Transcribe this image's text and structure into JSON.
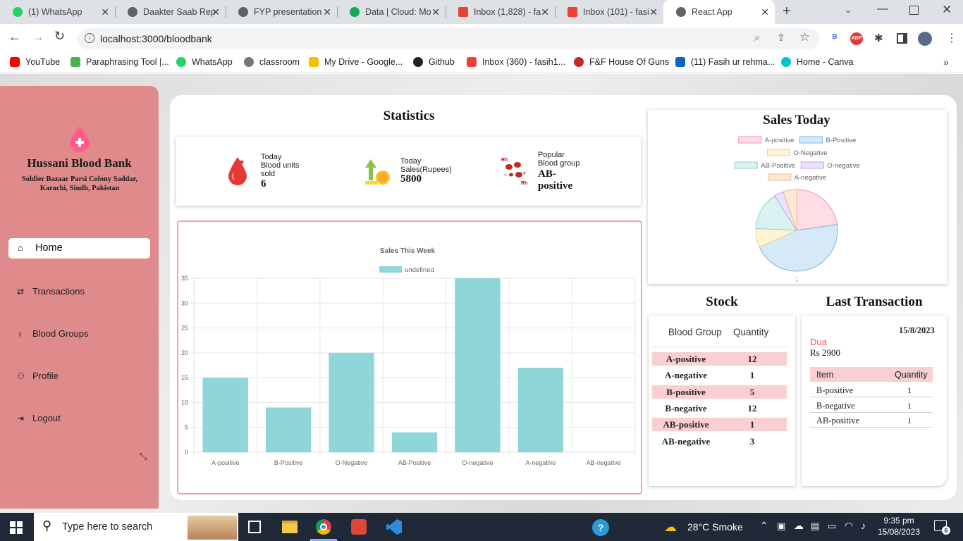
{
  "browser": {
    "tabs": [
      {
        "label": "(1) WhatsApp",
        "favicon_color": "#25d366"
      },
      {
        "label": "Daakter Saab Rep",
        "favicon_color": "#5f6368"
      },
      {
        "label": "FYP presentation",
        "favicon_color": "#5f6368"
      },
      {
        "label": "Data | Cloud: Mo",
        "favicon_color": "#13aa52"
      },
      {
        "label": "Inbox (1,828) - fa",
        "favicon_color": "#ea4335"
      },
      {
        "label": "Inbox (101) - fasi",
        "favicon_color": "#ea4335"
      },
      {
        "label": "React App",
        "favicon_color": "#5f6368"
      }
    ],
    "url": "localhost:3000/bloodbank",
    "bookmarks": [
      {
        "label": "YouTube",
        "color": "#ff0000"
      },
      {
        "label": "Paraphrasing Tool |...",
        "color": "#4caf50"
      },
      {
        "label": "WhatsApp",
        "color": "#25d366"
      },
      {
        "label": "classroom",
        "color": "#555555"
      },
      {
        "label": "My Drive - Google...",
        "color": "#fbbc04"
      },
      {
        "label": "Github",
        "color": "#222222"
      },
      {
        "label": "Inbox (360) - fasih1...",
        "color": "#ea4335"
      },
      {
        "label": "F&F House Of Guns",
        "color": "#c62828"
      },
      {
        "label": "(11) Fasih ur rehma...",
        "color": "#0a66c2"
      },
      {
        "label": "Home - Canva",
        "color": "#00c4cc"
      }
    ]
  },
  "sidebar": {
    "title": "Hussani Blood Bank",
    "address": "Soldier Bazaar Parsi Colony Saddar, Karachi, Sindh, Pakistan",
    "items": [
      {
        "label": "Home",
        "icon": "home-icon"
      },
      {
        "label": "Transactions",
        "icon": "transactions-icon"
      },
      {
        "label": "Blood Groups",
        "icon": "blood-drop-icon"
      },
      {
        "label": "Profile",
        "icon": "user-icon"
      },
      {
        "label": "Logout",
        "icon": "logout-icon"
      }
    ],
    "active": "Home"
  },
  "statistics": {
    "title": "Statistics",
    "units_label_1": "Today",
    "units_label_2": "Blood units",
    "units_label_3": "sold",
    "units_value": "6",
    "sales_label_1": "Today",
    "sales_label_2": "Sales(Rupees)",
    "sales_value": "5800",
    "popular_label_1": "Popular",
    "popular_label_2": "Blood group",
    "popular_value_1": "AB-",
    "popular_value_2": "positive"
  },
  "chart_data": [
    {
      "type": "bar",
      "title": "Sales This Week",
      "legend": [
        "undefined"
      ],
      "legend_position": "top",
      "categories": [
        "A-positive",
        "B-Positive",
        "O-Negative",
        "AB-Positive",
        "O-negative",
        "A-negative",
        "AB-negative"
      ],
      "values": [
        15,
        9,
        20,
        4,
        35,
        17,
        0
      ],
      "ylim": [
        0,
        35
      ],
      "yticks": [
        0,
        5,
        10,
        15,
        20,
        25,
        30,
        35
      ],
      "grid": true,
      "color": "#8fd6d9"
    },
    {
      "type": "pie",
      "title": "Sales Today",
      "labels": [
        "A-positive",
        "B-Positive",
        "O-Negative",
        "AB-Positive",
        "O-negative",
        "A-negative"
      ],
      "values": [
        3,
        6,
        1,
        2,
        0.5,
        0.7
      ],
      "colors": [
        "#ffdde4",
        "#d6e9f8",
        "#fff3d6",
        "#daf3f1",
        "#ebe2fb",
        "#ffe8d4"
      ],
      "borders": [
        "#f48fa8",
        "#75b6e3",
        "#f1cf83",
        "#88d6d0",
        "#bda7ec",
        "#f3b98a"
      ],
      "legend_position": "top",
      "caption": ";"
    }
  ],
  "stock": {
    "title": "Stock",
    "headers": [
      "Blood Group",
      "Quantity"
    ],
    "rows": [
      {
        "group": "A-positive",
        "qty": "12"
      },
      {
        "group": "A-negative",
        "qty": "1"
      },
      {
        "group": "B-positive",
        "qty": "5"
      },
      {
        "group": "B-negative",
        "qty": "12"
      },
      {
        "group": "AB-positive",
        "qty": "1"
      },
      {
        "group": "AB-negative",
        "qty": "3"
      }
    ]
  },
  "last_transaction": {
    "title": "Last Transaction",
    "date": "15/8/2023",
    "name": "Dua",
    "amount": "Rs 2900",
    "headers": [
      "Item",
      "Quantity"
    ],
    "rows": [
      {
        "item": "B-positive",
        "qty": "1"
      },
      {
        "item": "B-negative",
        "qty": "1"
      },
      {
        "item": "AB-positive",
        "qty": "1"
      }
    ]
  },
  "taskbar": {
    "search_placeholder": "Type here to search",
    "weather": "28°C  Smoke",
    "time": "9:35 pm",
    "date": "15/08/2023",
    "notifications": "6"
  }
}
